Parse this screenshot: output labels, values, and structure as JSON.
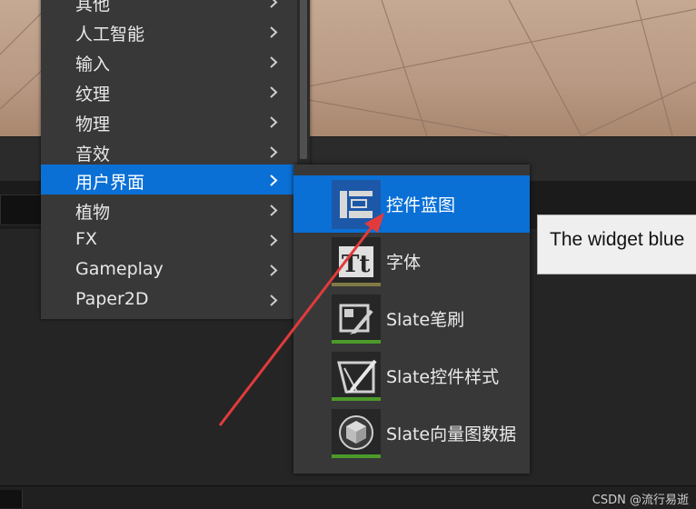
{
  "menu": {
    "items": [
      {
        "label": "其他"
      },
      {
        "label": "人工智能"
      },
      {
        "label": "输入"
      },
      {
        "label": "纹理"
      },
      {
        "label": "物理"
      },
      {
        "label": "音效"
      },
      {
        "label": "用户界面"
      },
      {
        "label": "植物"
      },
      {
        "label": "FX"
      },
      {
        "label": "Gameplay"
      },
      {
        "label": "Paper2D"
      }
    ],
    "active_index": 6
  },
  "submenu": {
    "items": [
      {
        "label": "控件蓝图",
        "icon": "widget-blueprint-icon"
      },
      {
        "label": "字体",
        "icon": "font-icon"
      },
      {
        "label": "Slate笔刷",
        "icon": "slate-brush-icon"
      },
      {
        "label": "Slate控件样式",
        "icon": "slate-widget-style-icon"
      },
      {
        "label": "Slate向量图数据",
        "icon": "slate-vector-art-icon"
      }
    ],
    "active_index": 0
  },
  "tooltip": {
    "text": "The widget blue"
  },
  "watermark": {
    "text": "CSDN @流行易逝"
  },
  "colors": {
    "accent": "#0a70d6",
    "font_bar": "#807a45",
    "slate_bar": "#4c9a2a",
    "annotation": "#e23b3b"
  }
}
